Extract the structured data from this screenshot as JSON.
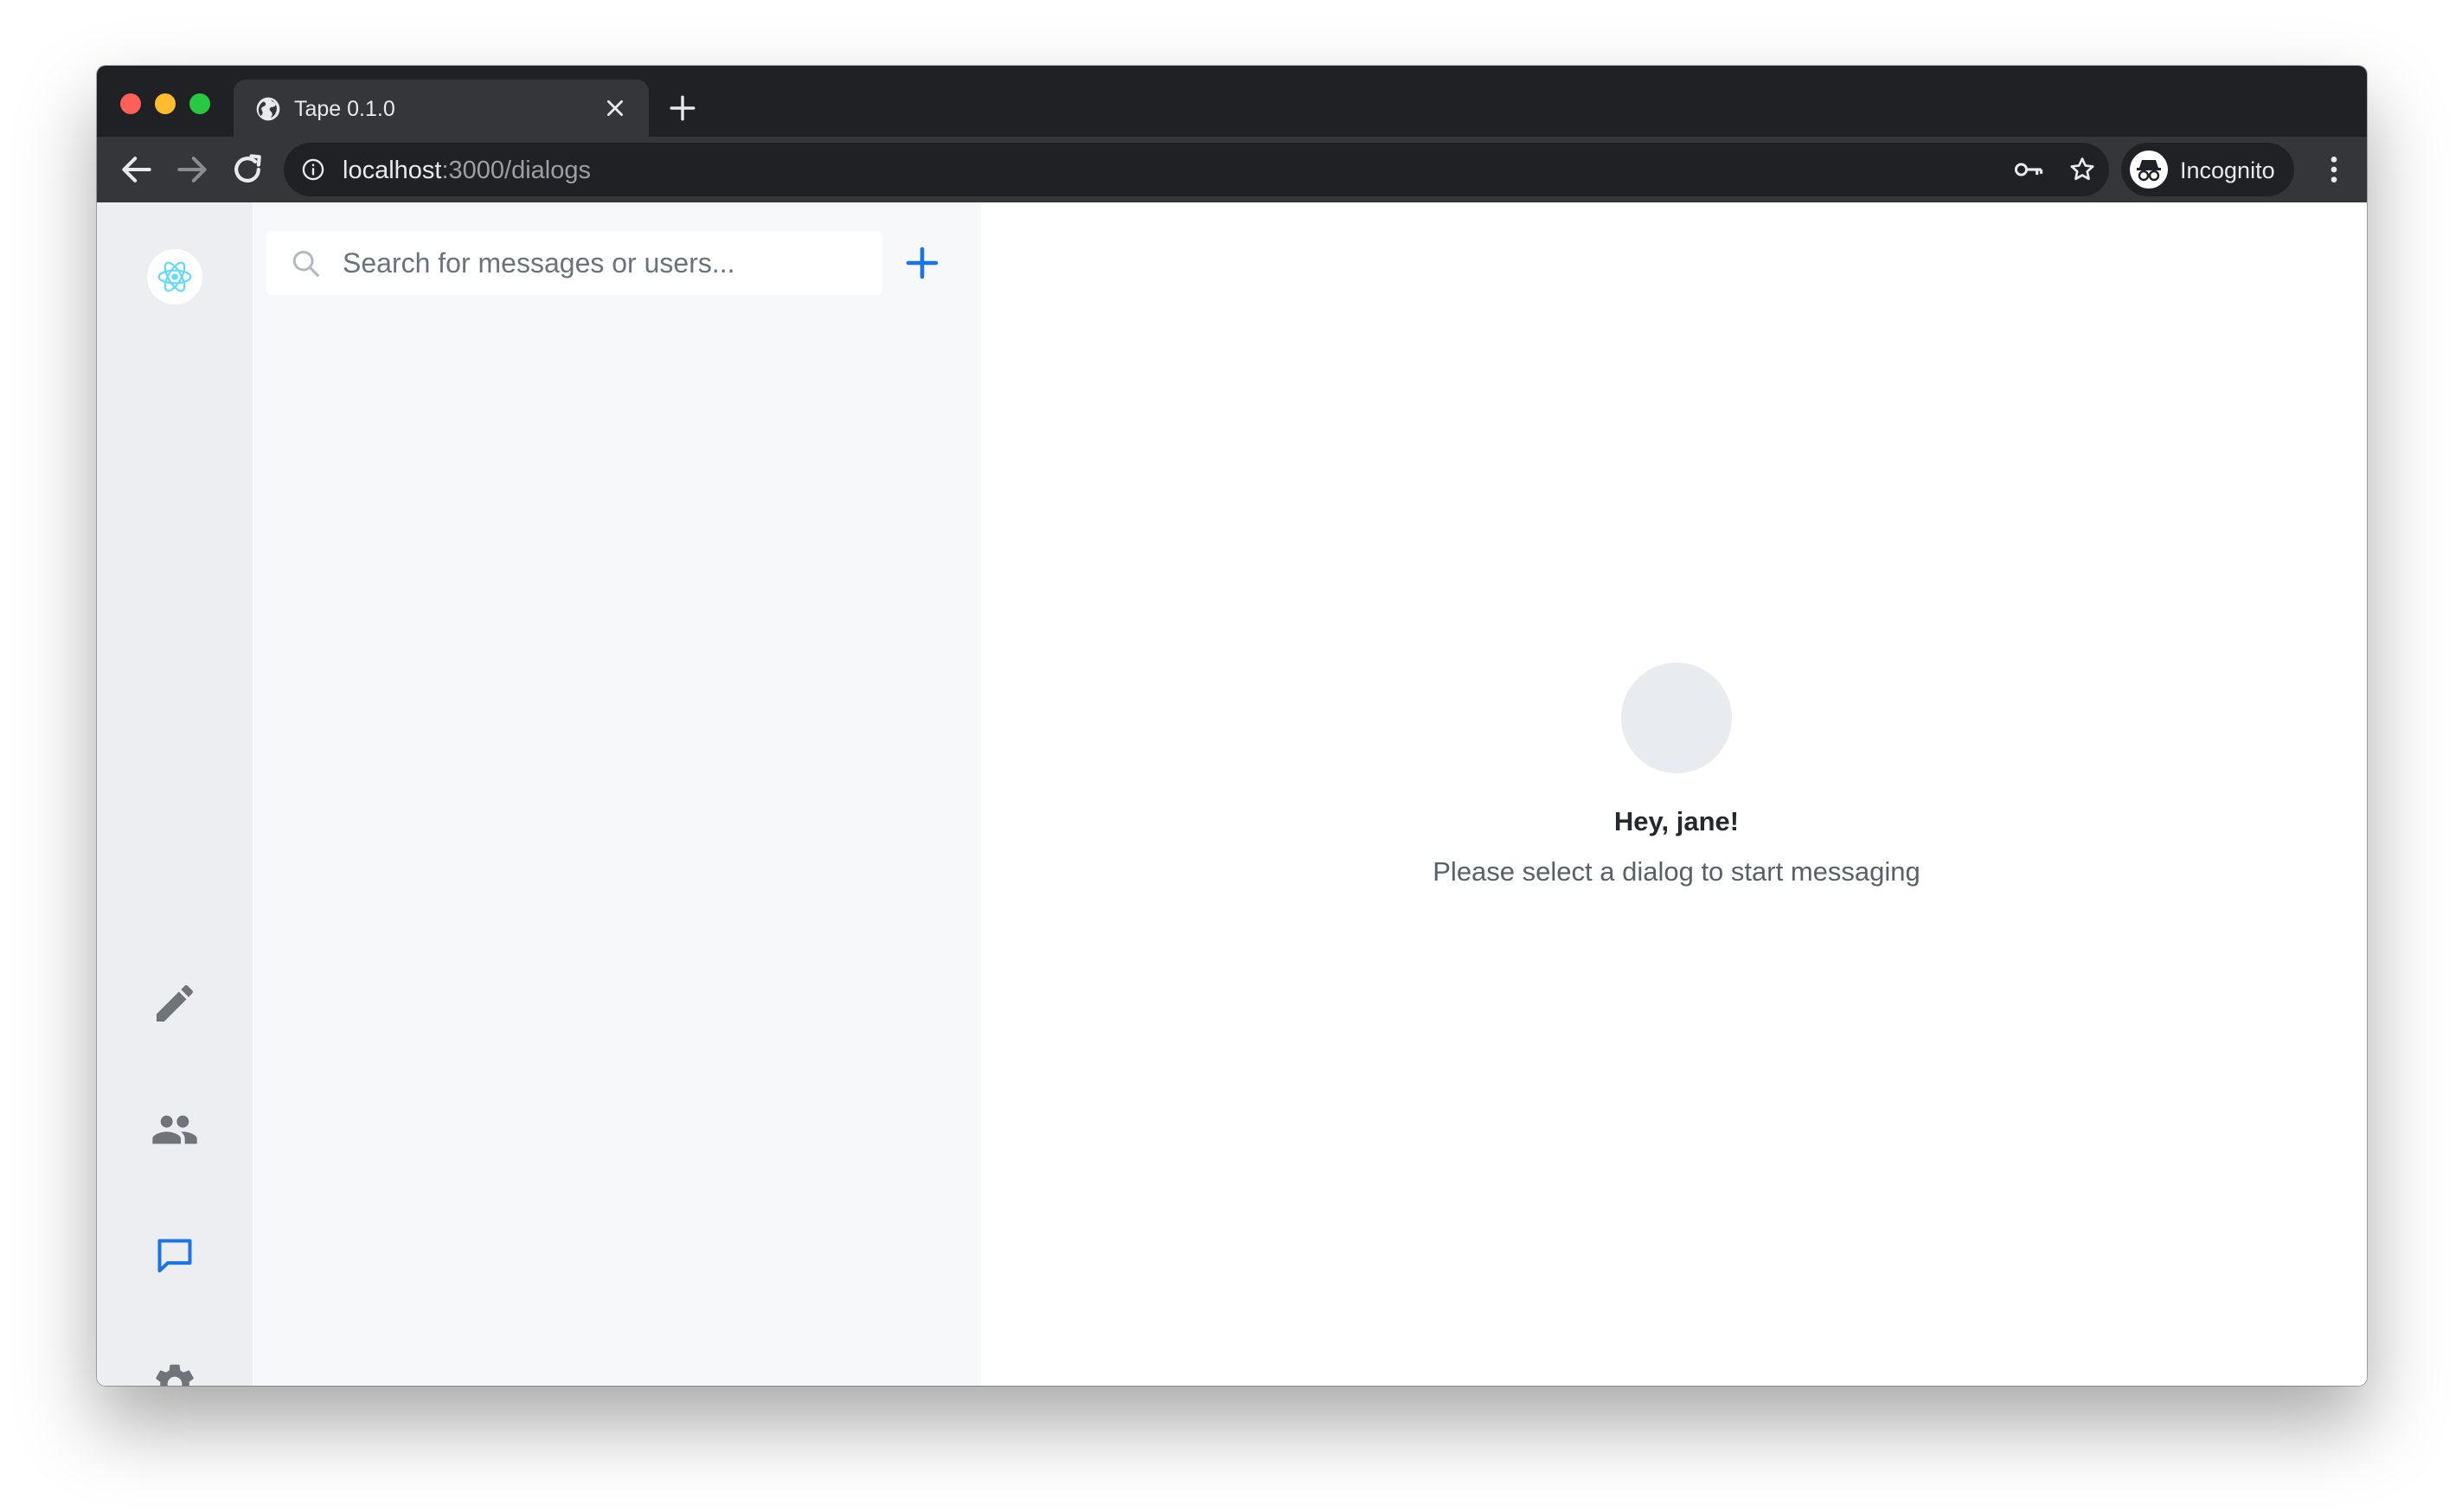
{
  "browser": {
    "tab": {
      "title": "Tape 0.1.0",
      "icon": "globe-icon"
    },
    "address": {
      "host": "localhost",
      "path": ":3000/dialogs"
    },
    "profile": {
      "label": "Incognito",
      "icon": "incognito-icon"
    }
  },
  "app": {
    "logo": "react-logo-icon",
    "nav": [
      {
        "id": "compose",
        "icon": "pencil-icon",
        "active": false
      },
      {
        "id": "contacts",
        "icon": "people-icon",
        "active": false
      },
      {
        "id": "dialogs",
        "icon": "chat-icon",
        "active": true
      },
      {
        "id": "settings",
        "icon": "gear-icon",
        "active": false
      }
    ],
    "search": {
      "placeholder": "Search for messages or users...",
      "value": ""
    },
    "welcome": {
      "title": "Hey, jane!",
      "subtitle": "Please select a dialog to start messaging"
    }
  },
  "colors": {
    "accent": "#1a73e8",
    "rail_bg": "#eceef1",
    "list_bg": "#f6f8fa",
    "icon_gray": "#6f747a",
    "react_logo": "#61dafb"
  }
}
